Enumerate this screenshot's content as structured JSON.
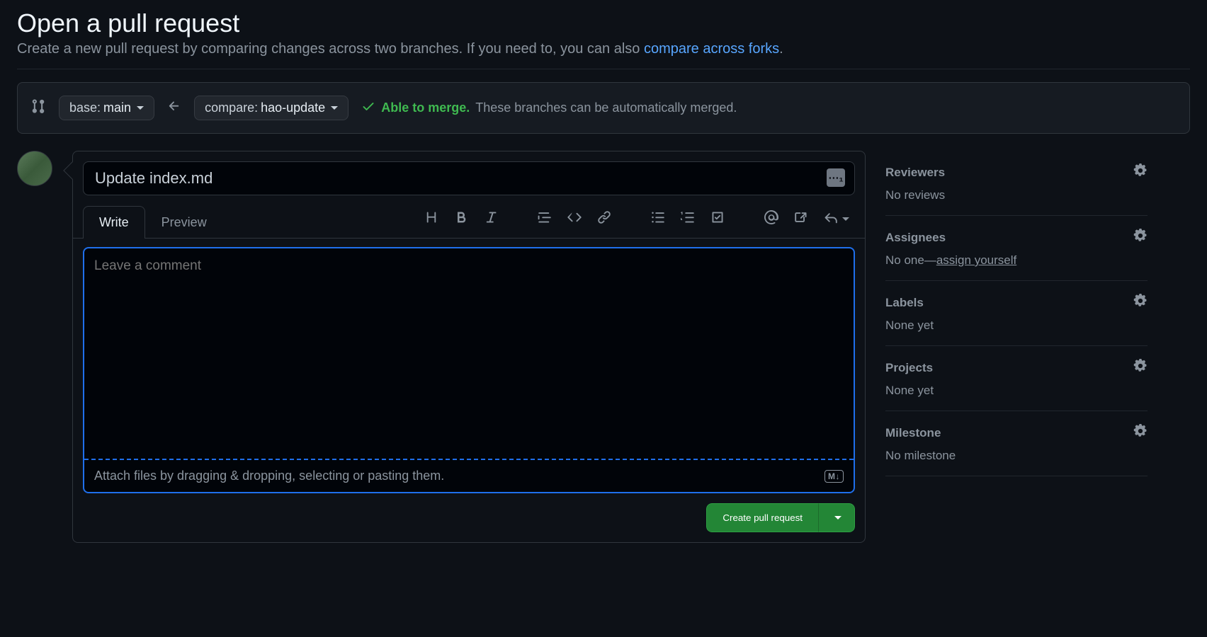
{
  "header": {
    "title": "Open a pull request",
    "subtitle_prefix": "Create a new pull request by comparing changes across two branches. If you need to, you can also ",
    "subtitle_link": "compare across forks",
    "subtitle_suffix": "."
  },
  "branch_bar": {
    "base_label": "base: ",
    "base_value": "main",
    "compare_label": "compare: ",
    "compare_value": "hao-update",
    "check_icon": "check-icon",
    "merge_able": "Able to merge.",
    "merge_text": "These branches can be automatically merged."
  },
  "pr_form": {
    "title_value": "Update index.md",
    "tabs": {
      "write": "Write",
      "preview": "Preview"
    },
    "comment_placeholder": "Leave a comment",
    "attach_text": "Attach files by dragging & dropping, selecting or pasting them.",
    "md_badge": "M↓",
    "create_button": "Create pull request"
  },
  "sidebar": {
    "reviewers": {
      "title": "Reviewers",
      "value": "No reviews"
    },
    "assignees": {
      "title": "Assignees",
      "value_prefix": "No one—",
      "assign_link": "assign yourself"
    },
    "labels": {
      "title": "Labels",
      "value": "None yet"
    },
    "projects": {
      "title": "Projects",
      "value": "None yet"
    },
    "milestone": {
      "title": "Milestone",
      "value": "No milestone"
    }
  }
}
